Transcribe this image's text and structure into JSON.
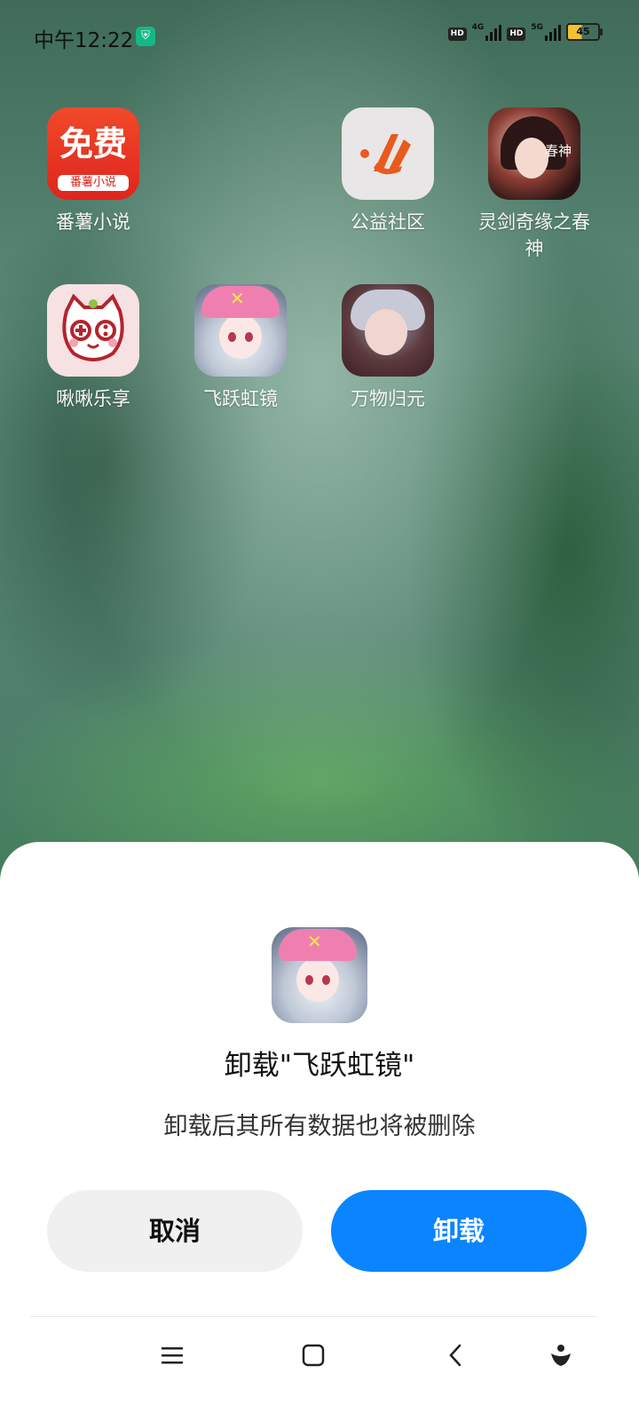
{
  "status_bar": {
    "time": "中午12:22",
    "hd1": "HD",
    "net1": "4G",
    "hd2": "HD",
    "net2": "5G",
    "battery": "45"
  },
  "apps": [
    {
      "label": "番薯小说",
      "icon_text_big": "免费",
      "icon_text_small": "番薯小说"
    },
    {
      "label": "公益社区"
    },
    {
      "label": "灵剑奇缘之春神",
      "icon_text": "春神"
    },
    {
      "label": "啾啾乐享"
    },
    {
      "label": "飞跃虹镜"
    },
    {
      "label": "万物归元"
    }
  ],
  "dialog": {
    "title": "卸载\"飞跃虹镜\"",
    "message": "卸载后其所有数据也将被删除",
    "cancel_label": "取消",
    "uninstall_label": "卸载",
    "accent_color": "#0a84ff"
  },
  "nav_bar": {
    "icons": [
      "menu-icon",
      "home-icon",
      "back-icon",
      "assistant-icon"
    ]
  }
}
